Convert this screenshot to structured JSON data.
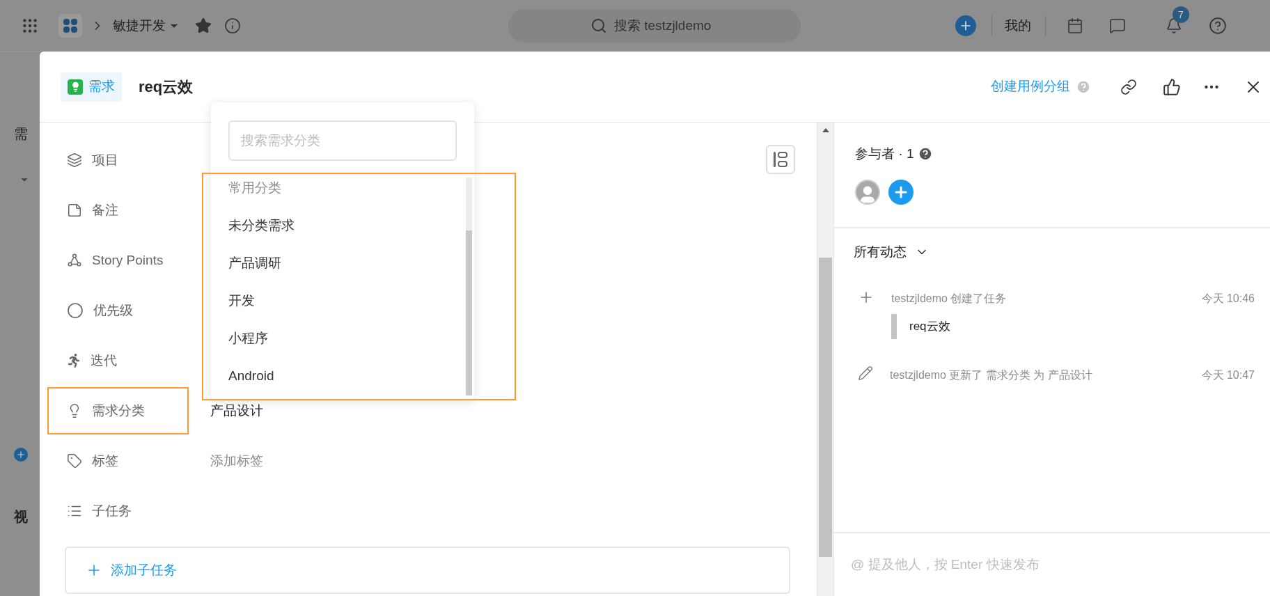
{
  "top_bar": {
    "breadcrumb": "敏捷开发",
    "search": {
      "placeholder": "搜索 testzjldemo"
    },
    "my_label": "我的",
    "notification_count": "7"
  },
  "background": {
    "section_title": "需",
    "view_title": "视"
  },
  "dialog": {
    "type_tag": "需求",
    "title": "req云效",
    "create_case_group": "创建用例分组"
  },
  "fields": [
    {
      "kind": "project",
      "label": "项目",
      "highlighted": false
    },
    {
      "kind": "note",
      "label": "备注",
      "highlighted": false
    },
    {
      "kind": "story_points",
      "label": "Story Points",
      "highlighted": false
    },
    {
      "kind": "priority",
      "label": "优先级",
      "highlighted": false
    },
    {
      "kind": "iteration",
      "label": "迭代",
      "highlighted": false
    },
    {
      "kind": "category",
      "label": "需求分类",
      "value": "产品设计",
      "highlighted": true
    },
    {
      "kind": "tag",
      "label": "标签",
      "placeholder": "添加标签",
      "highlighted": false
    },
    {
      "kind": "subtasks",
      "label": "子任务",
      "highlighted": false
    }
  ],
  "add_subtask_button": "添加子任务",
  "category_dropdown": {
    "search": {
      "placeholder": "搜索需求分类"
    },
    "group_label": "常用分类",
    "highlighted": true,
    "options": [
      {
        "label": "未分类需求"
      },
      {
        "label": "产品调研"
      },
      {
        "label": "开发"
      },
      {
        "label": "小程序"
      },
      {
        "label": "Android"
      }
    ]
  },
  "participants": {
    "title": "参与者 · 1"
  },
  "activity": {
    "filter": "所有动态",
    "entries": [
      {
        "kind": "create",
        "text": "testzjldemo 创建了任务",
        "time": "今天 10:46",
        "quote": "req云效"
      },
      {
        "kind": "update",
        "text": "testzjldemo 更新了 需求分类 为 产品设计",
        "time": "今天 10:47"
      }
    ]
  },
  "comment": {
    "placeholder": "@ 提及他人，按 Enter 快速发布"
  }
}
